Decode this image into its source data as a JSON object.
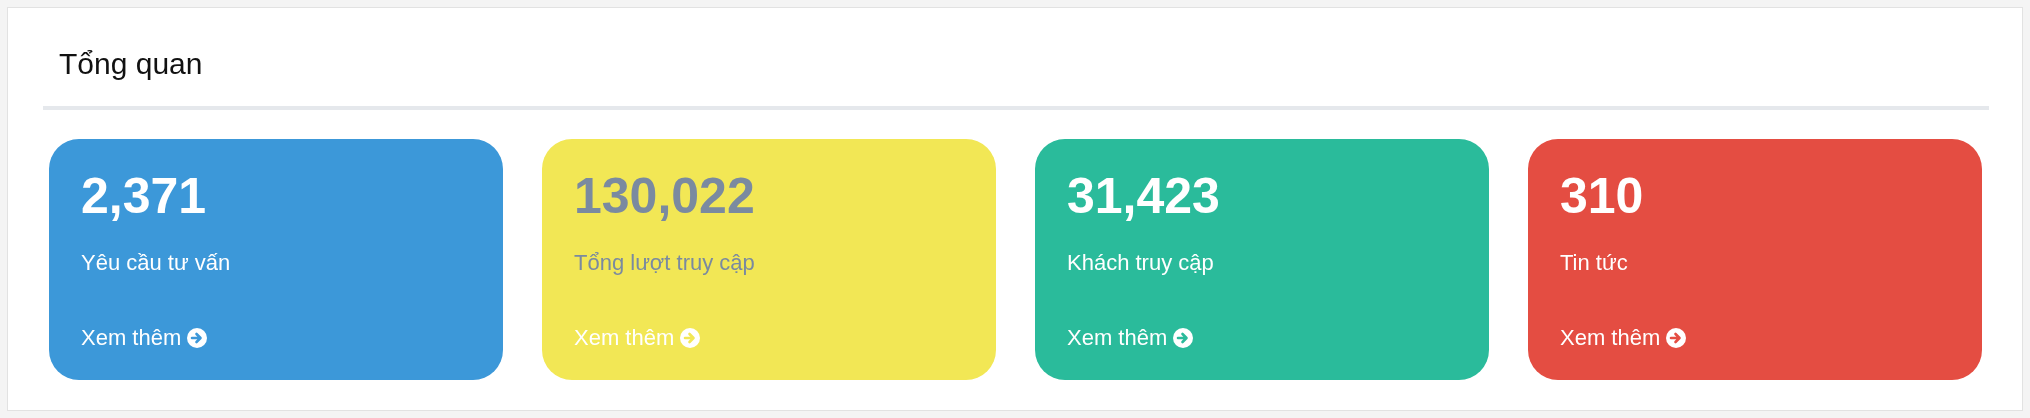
{
  "panel": {
    "title": "Tổng quan"
  },
  "stats": [
    {
      "value": "2,371",
      "label": "Yêu cầu tư vấn",
      "link": "Xem thêm",
      "color": "#3c98d9"
    },
    {
      "value": "130,022",
      "label": "Tổng lượt truy cập",
      "link": "Xem thêm",
      "color": "#f2e755"
    },
    {
      "value": "31,423",
      "label": "Khách truy cập",
      "link": "Xem thêm",
      "color": "#2abb9b"
    },
    {
      "value": "310",
      "label": "Tin tức",
      "link": "Xem thêm",
      "color": "#e44d42"
    }
  ]
}
